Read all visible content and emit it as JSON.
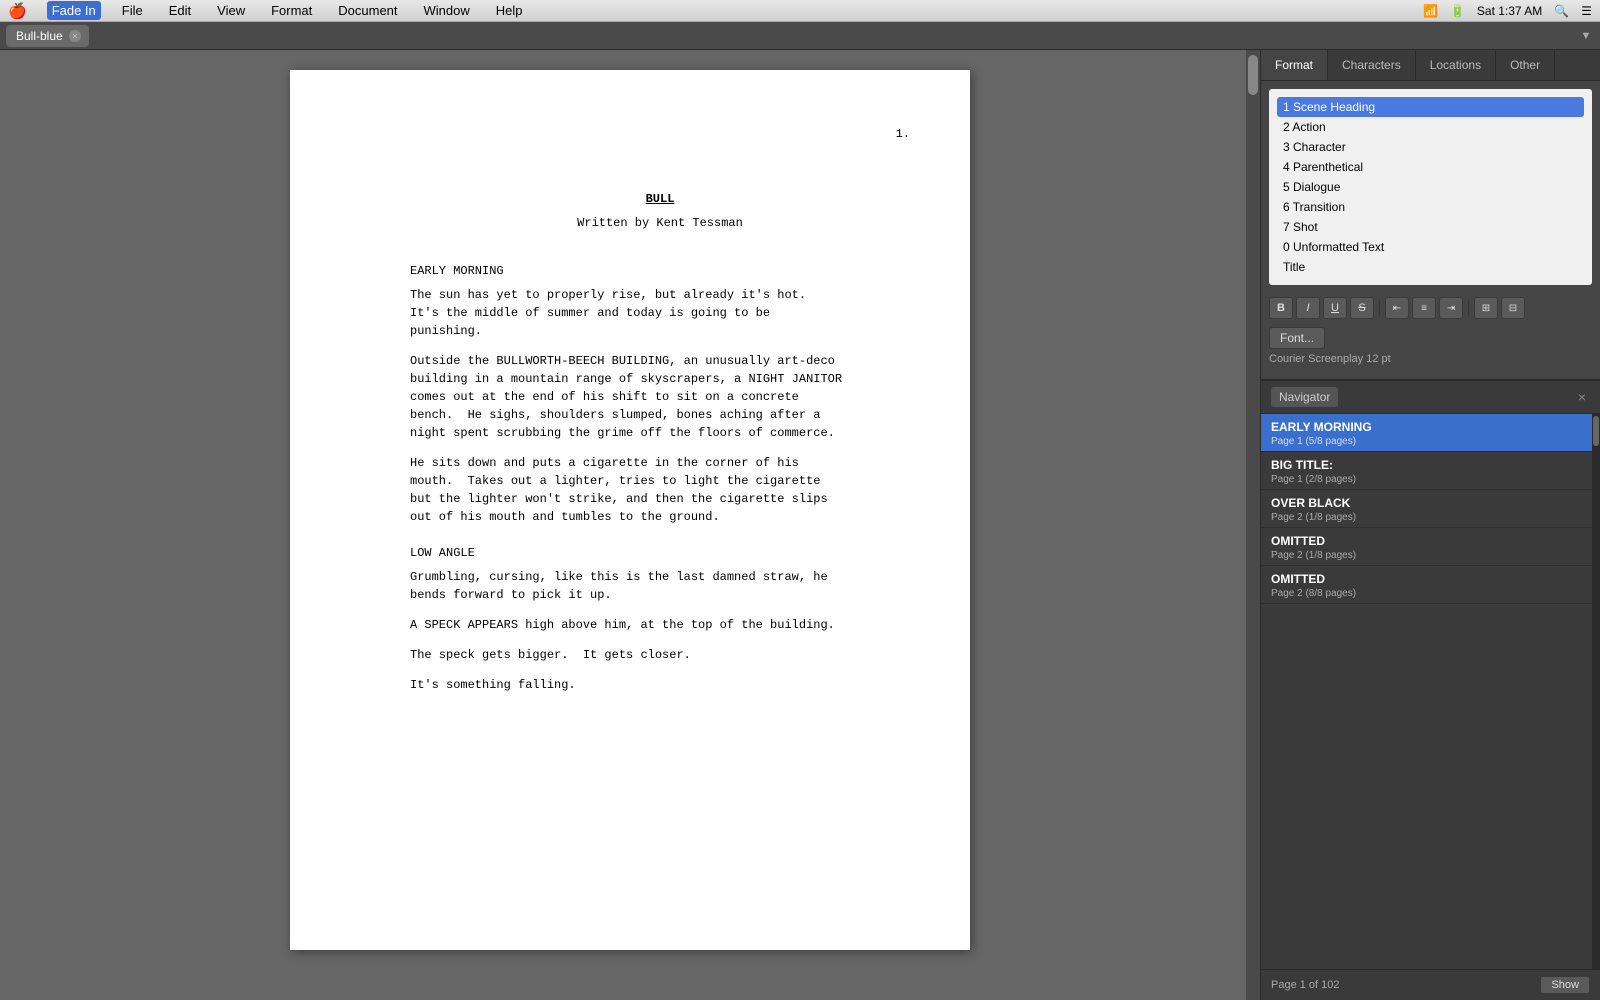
{
  "menubar": {
    "apple": "🍎",
    "items": [
      "Fade In",
      "File",
      "Edit",
      "View",
      "Format",
      "Document",
      "Window",
      "Help"
    ],
    "active_item": "Fade In",
    "right": {
      "wifi": "wifi",
      "battery": "battery",
      "datetime": "Sat 1:37 AM",
      "search": "search",
      "menu": "menu"
    }
  },
  "tabbar": {
    "tab_label": "Bull-blue",
    "close_label": "×"
  },
  "format_panel": {
    "tabs": [
      "Format",
      "Characters",
      "Locations",
      "Other"
    ],
    "active_tab": "Format",
    "format_items": [
      {
        "key": "1",
        "label": "Scene Heading",
        "selected": true
      },
      {
        "key": "2",
        "label": "Action",
        "selected": false
      },
      {
        "key": "3",
        "label": "Character",
        "selected": false
      },
      {
        "key": "4",
        "label": "Parenthetical",
        "selected": false
      },
      {
        "key": "5",
        "label": "Dialogue",
        "selected": false
      },
      {
        "key": "6",
        "label": "Transition",
        "selected": false
      },
      {
        "key": "7",
        "label": "Shot",
        "selected": false
      },
      {
        "key": "0",
        "label": "Unformatted Text",
        "selected": false
      },
      {
        "key": "",
        "label": "Title",
        "selected": false
      }
    ],
    "toolbar_buttons": [
      "B",
      "I",
      "U",
      "S"
    ],
    "font_button": "Font...",
    "font_info": "Courier Screenplay 12 pt"
  },
  "navigator": {
    "tab_label": "Navigator",
    "close_label": "×",
    "items": [
      {
        "title": "EARLY MORNING",
        "sub": "Page 1 (5/8 pages)",
        "active": true
      },
      {
        "title": "BIG TITLE:",
        "sub": "Page 1 (2/8 pages)",
        "active": false
      },
      {
        "title": "OVER BLACK",
        "sub": "Page 2 (1/8 pages)",
        "active": false
      },
      {
        "title": "OMITTED",
        "sub": "Page 2 (1/8 pages)",
        "active": false
      },
      {
        "title": "OMITTED",
        "sub": "Page 2 (8/8 pages)",
        "active": false
      }
    ],
    "footer_page": "Page 1 of 102",
    "show_button": "Show"
  },
  "script": {
    "page_number": "1.",
    "title": "BULL",
    "byline": "Written by Kent Tessman",
    "content": [
      {
        "type": "scene",
        "text": "EARLY MORNING"
      },
      {
        "type": "action",
        "text": "The sun has yet to properly rise, but already it's hot.\nIt's the middle of summer and today is going to be\npunishing."
      },
      {
        "type": "action",
        "text": "Outside the BULLWORTH-BEECH BUILDING, an unusually art-deco\nbuilding in a mountain range of skyscrapers, a NIGHT JANITOR\ncomes out at the end of his shift to sit on a concrete\nbench.  He sighs, shoulders slumped, bones aching after a\nnight spent scrubbing the grime off the floors of commerce."
      },
      {
        "type": "action",
        "text": "He sits down and puts a cigarette in the corner of his\nmouth.  Takes out a lighter, tries to light the cigarette\nbut the lighter won't strike, and then the cigarette slips\nout of his mouth and tumbles to the ground."
      },
      {
        "type": "scene",
        "text": "LOW ANGLE"
      },
      {
        "type": "action",
        "text": "Grumbling, cursing, like this is the last damned straw, he\nbends forward to pick it up."
      },
      {
        "type": "action",
        "text": "A SPECK APPEARS high above him, at the top of the building."
      },
      {
        "type": "action",
        "text": "The speck gets bigger.  It gets closer."
      },
      {
        "type": "action",
        "text": "It's something falling."
      }
    ]
  }
}
